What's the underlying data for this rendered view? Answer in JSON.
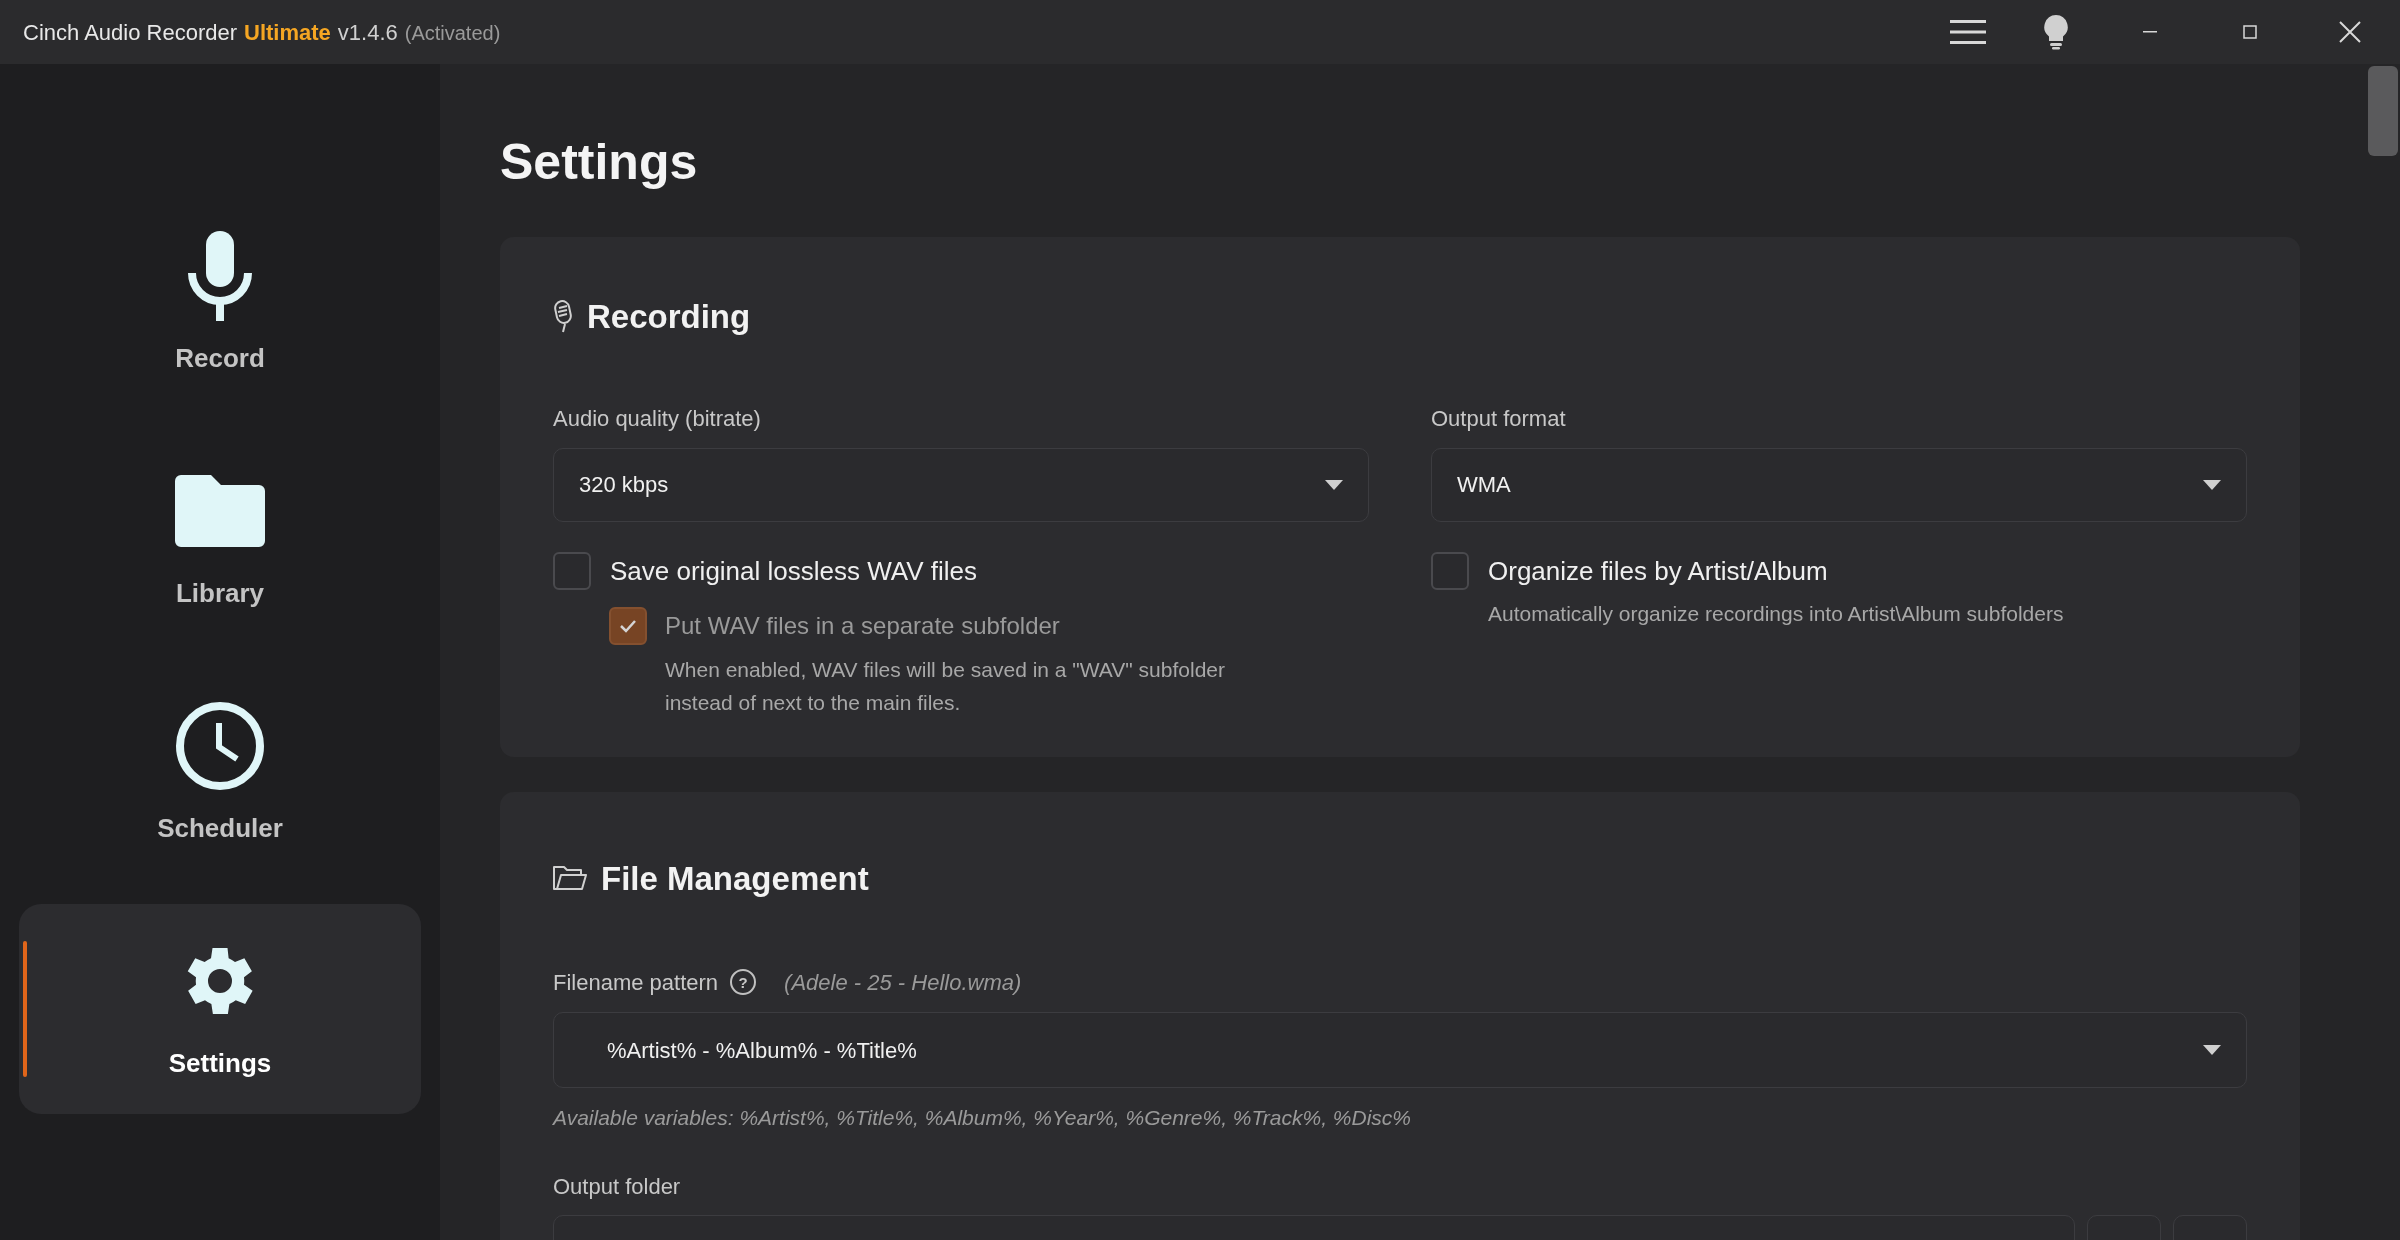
{
  "window": {
    "app_name": "Cinch Audio Recorder",
    "edition": "Ultimate",
    "version": "v1.4.6",
    "status": "(Activated)"
  },
  "sidebar": {
    "items": [
      {
        "kind": "record",
        "label": "Record",
        "selected": false
      },
      {
        "kind": "library",
        "label": "Library",
        "selected": false
      },
      {
        "kind": "scheduler",
        "label": "Scheduler",
        "selected": false
      },
      {
        "kind": "settings",
        "label": "Settings",
        "selected": true
      }
    ]
  },
  "page_title": "Settings",
  "recording": {
    "title": "Recording",
    "audio_quality": {
      "label": "Audio quality (bitrate)",
      "value": "320 kbps"
    },
    "output_format": {
      "label": "Output format",
      "value": "WMA"
    },
    "save_wav": {
      "label": "Save original lossless WAV files",
      "checked": false
    },
    "wav_subfolder": {
      "label": "Put WAV files in a separate subfolder",
      "checked": true,
      "disabled": true,
      "description": "When enabled, WAV files will be saved in a \"WAV\" subfolder instead of next to the main files."
    },
    "organize": {
      "label": "Organize files by Artist/Album",
      "checked": false,
      "description": "Automatically organize recordings into Artist\\Album subfolders"
    }
  },
  "file_management": {
    "title": "File Management",
    "filename_pattern": {
      "label": "Filename pattern",
      "help": "?",
      "example": "(Adele - 25 - Hello.wma)",
      "value": "%Artist% - %Album% - %Title%",
      "hint": "Available variables: %Artist%, %Title%, %Album%, %Year%, %Genre%, %Track%, %Disc%"
    },
    "output_folder": {
      "label": "Output folder"
    }
  }
}
